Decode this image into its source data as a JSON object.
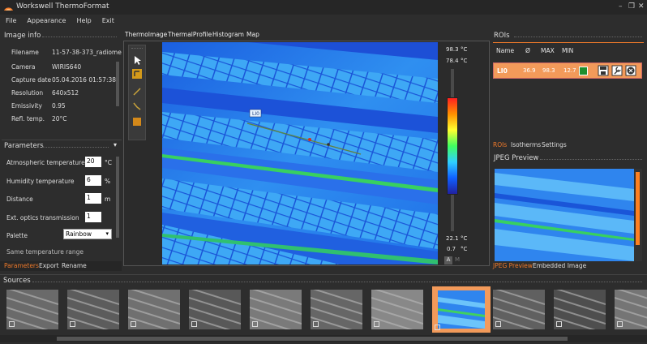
{
  "app": {
    "title": "Workswell ThermoFormat"
  },
  "window_controls": {
    "minimize": "–",
    "restore": "❐",
    "close": "✕"
  },
  "menu": [
    "File",
    "Appearance",
    "Help",
    "Exit"
  ],
  "image_info": {
    "title": "Image info",
    "rows": [
      {
        "label": "Filename",
        "value": "11-57-38-373_radiome"
      },
      {
        "label": "Camera",
        "value": "WIRIS640"
      },
      {
        "label": "Capture date",
        "value": "05.04.2016 01:57:38"
      },
      {
        "label": "Resolution",
        "value": "640x512"
      },
      {
        "label": "Emissivity",
        "value": "0.95"
      },
      {
        "label": "Refl. temp.",
        "value": "20°C"
      }
    ]
  },
  "parameters": {
    "title": "Parameters",
    "collapse_icon": "▾",
    "atm_label": "Atmospheric temperature",
    "atm_value": "20",
    "atm_unit": "°C",
    "hum_label": "Humidity temperature",
    "hum_value": "6",
    "hum_unit": "%",
    "dist_label": "Distance",
    "dist_value": "1",
    "dist_unit": "m",
    "ext_label": "Ext. optics transmission",
    "ext_value": "1",
    "palette_label": "Palette",
    "palette_value": "Rainbow",
    "same_label": "Same temperature range"
  },
  "left_tabs": [
    "Parameters",
    "Export",
    "Rename"
  ],
  "view_tabs": [
    "ThermoImage",
    "ThermalProfile",
    "Histogram",
    "Map"
  ],
  "roi_label": "LI0",
  "scale": {
    "max_top": "98.3",
    "max2": "78.4",
    "min2": "22.1",
    "min_bottom": "0.7",
    "unit": "°C",
    "auto": "A",
    "manual": "M"
  },
  "rois": {
    "title": "ROIs",
    "headers": [
      "Name",
      "Ø",
      "MAX",
      "MIN"
    ],
    "row": {
      "name": "LI0",
      "avg": "36.9",
      "max": "98.3",
      "min": "12.7",
      "color": "#1e8f2e"
    }
  },
  "right_tabs": [
    "ROIs",
    "Isotherms",
    "Settings"
  ],
  "jpeg": {
    "title": "JPEG Preview",
    "tabs": [
      "JPEG Preview",
      "Embedded Image"
    ]
  },
  "sources": {
    "title": "Sources",
    "count": 11,
    "selected_index": 7
  },
  "colors": {
    "accent": "#f07a2a",
    "panel": "#2d2d2d",
    "header": "#3c3c3c"
  }
}
